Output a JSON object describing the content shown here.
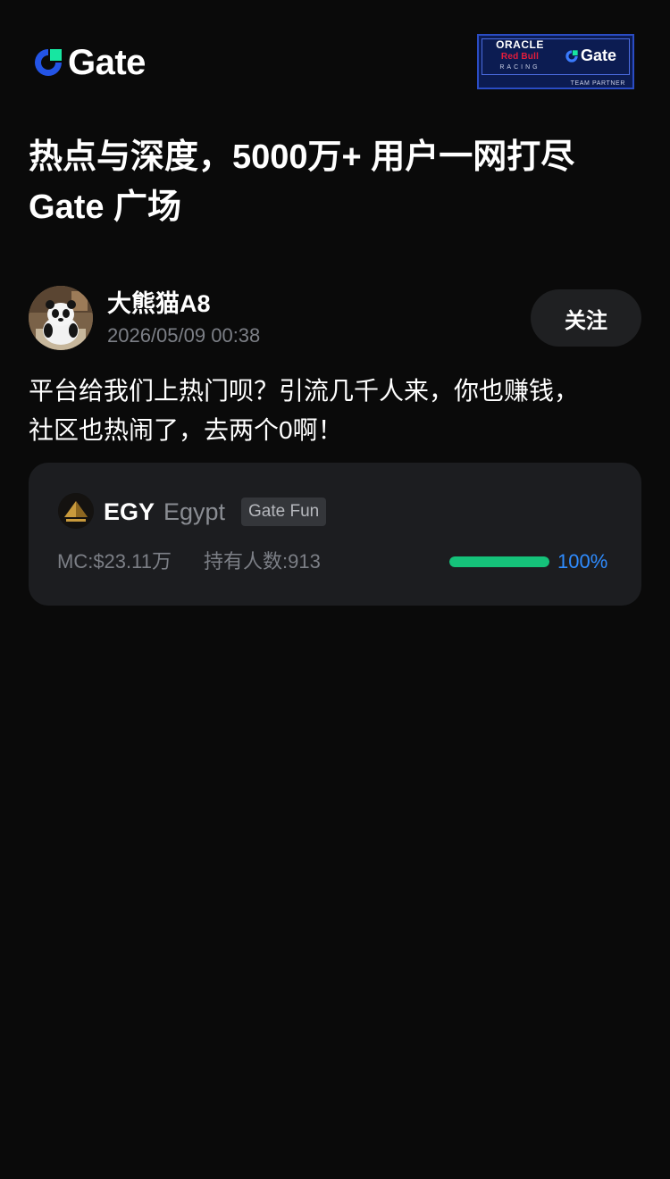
{
  "header": {
    "logo_text": "Gate",
    "partner": {
      "line1": "ORACLE",
      "line2": "Red Bull",
      "line3": "RACING",
      "brand": "Gate",
      "caption": "TEAM PARTNER"
    }
  },
  "headline": {
    "line1": "热点与深度，5000万+ 用户一网打尽",
    "line2": "Gate 广场"
  },
  "post": {
    "username": "大熊猫A8",
    "timestamp": "2026/05/09 00:38",
    "follow_label": "关注",
    "text_line1": "平台给我们上热门呗？引流几千人来，你也赚钱，",
    "text_line2": "社区也热闹了，去两个0啊！"
  },
  "token": {
    "symbol": "EGY",
    "name": "Egypt",
    "tag": "Gate Fun",
    "market_cap": "MC:$23.11万",
    "holders": "持有人数:913",
    "progress_fraction": 1.0,
    "progress_label": "100%"
  },
  "colors": {
    "background": "#0a0a0a",
    "accent_blue": "#2f8cff",
    "progress_green": "#15c27a",
    "card": "#1c1d20"
  }
}
